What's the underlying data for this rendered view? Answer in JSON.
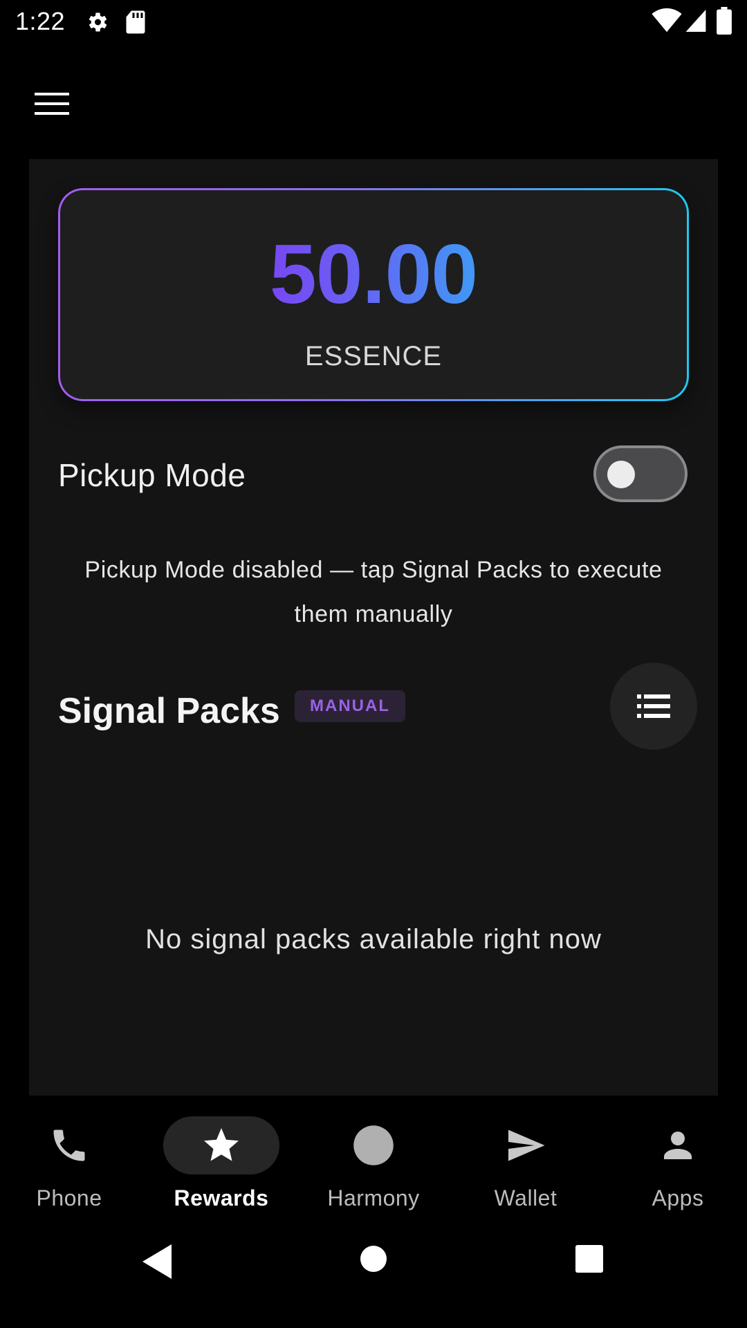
{
  "status_bar": {
    "time": "1:22",
    "icons": [
      "settings-icon",
      "sd-card-icon",
      "wifi-icon",
      "signal-icon",
      "battery-icon"
    ]
  },
  "app_bar": {
    "menu_icon": "menu-icon"
  },
  "balance": {
    "value": "50.00",
    "unit": "ESSENCE"
  },
  "pickup_mode": {
    "label": "Pickup Mode",
    "enabled": false,
    "description": "Pickup Mode disabled — tap Signal Packs to execute them manually"
  },
  "signal_packs": {
    "title": "Signal Packs",
    "badge": "MANUAL",
    "list_icon": "list-icon",
    "empty_message": "No signal packs available right now"
  },
  "bottom_nav": {
    "items": [
      {
        "label": "Phone",
        "icon": "phone-icon",
        "active": false
      },
      {
        "label": "Rewards",
        "icon": "star-icon",
        "active": true
      },
      {
        "label": "Harmony",
        "icon": "circle-icon",
        "active": false
      },
      {
        "label": "Wallet",
        "icon": "send-icon",
        "active": false
      },
      {
        "label": "Apps",
        "icon": "person-icon",
        "active": false
      }
    ]
  },
  "system_nav": {
    "icons": [
      "back-icon",
      "home-icon",
      "recents-icon"
    ]
  },
  "colors": {
    "background": "#000000",
    "panel": "#141414",
    "gradient_start": "#9a10f6",
    "gradient_end": "#1ccdf8",
    "badge_text": "#9a62e6"
  }
}
